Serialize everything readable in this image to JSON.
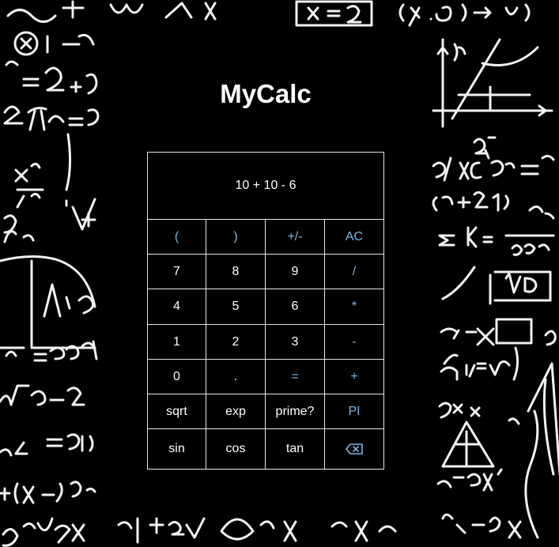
{
  "app": {
    "title": "MyCalc"
  },
  "display": {
    "expression": "10 + 10 - 6"
  },
  "keypad": {
    "rows": [
      [
        {
          "label": "(",
          "name": "open-paren-button",
          "type": "op"
        },
        {
          "label": ")",
          "name": "close-paren-button",
          "type": "op"
        },
        {
          "label": "+/-",
          "name": "negate-button",
          "type": "op"
        },
        {
          "label": "AC",
          "name": "all-clear-button",
          "type": "op"
        }
      ],
      [
        {
          "label": "7",
          "name": "digit-7-button",
          "type": "num"
        },
        {
          "label": "8",
          "name": "digit-8-button",
          "type": "num"
        },
        {
          "label": "9",
          "name": "digit-9-button",
          "type": "num"
        },
        {
          "label": "/",
          "name": "divide-button",
          "type": "op"
        }
      ],
      [
        {
          "label": "4",
          "name": "digit-4-button",
          "type": "num"
        },
        {
          "label": "5",
          "name": "digit-5-button",
          "type": "num"
        },
        {
          "label": "6",
          "name": "digit-6-button",
          "type": "num"
        },
        {
          "label": "*",
          "name": "multiply-button",
          "type": "op"
        }
      ],
      [
        {
          "label": "1",
          "name": "digit-1-button",
          "type": "num"
        },
        {
          "label": "2",
          "name": "digit-2-button",
          "type": "num"
        },
        {
          "label": "3",
          "name": "digit-3-button",
          "type": "num"
        },
        {
          "label": "-",
          "name": "subtract-button",
          "type": "op"
        }
      ],
      [
        {
          "label": "0",
          "name": "digit-0-button",
          "type": "num"
        },
        {
          "label": ".",
          "name": "decimal-point-button",
          "type": "num"
        },
        {
          "label": "=",
          "name": "equals-button",
          "type": "op"
        },
        {
          "label": "+",
          "name": "add-button",
          "type": "op"
        }
      ],
      [
        {
          "label": "sqrt",
          "name": "sqrt-button",
          "type": "num"
        },
        {
          "label": "exp",
          "name": "exp-button",
          "type": "num"
        },
        {
          "label": "prime?",
          "name": "prime-check-button",
          "type": "num"
        },
        {
          "label": "PI",
          "name": "pi-button",
          "type": "op"
        }
      ],
      [
        {
          "label": "sin",
          "name": "sin-button",
          "type": "num"
        },
        {
          "label": "cos",
          "name": "cos-button",
          "type": "num"
        },
        {
          "label": "tan",
          "name": "tan-button",
          "type": "num"
        },
        {
          "label": "",
          "name": "backspace-button",
          "type": "op",
          "icon": "backspace-icon"
        }
      ]
    ]
  },
  "colors": {
    "background": "#000000",
    "text": "#ffffff",
    "operator": "#7fb6e0",
    "border": "#e6e6e6"
  }
}
